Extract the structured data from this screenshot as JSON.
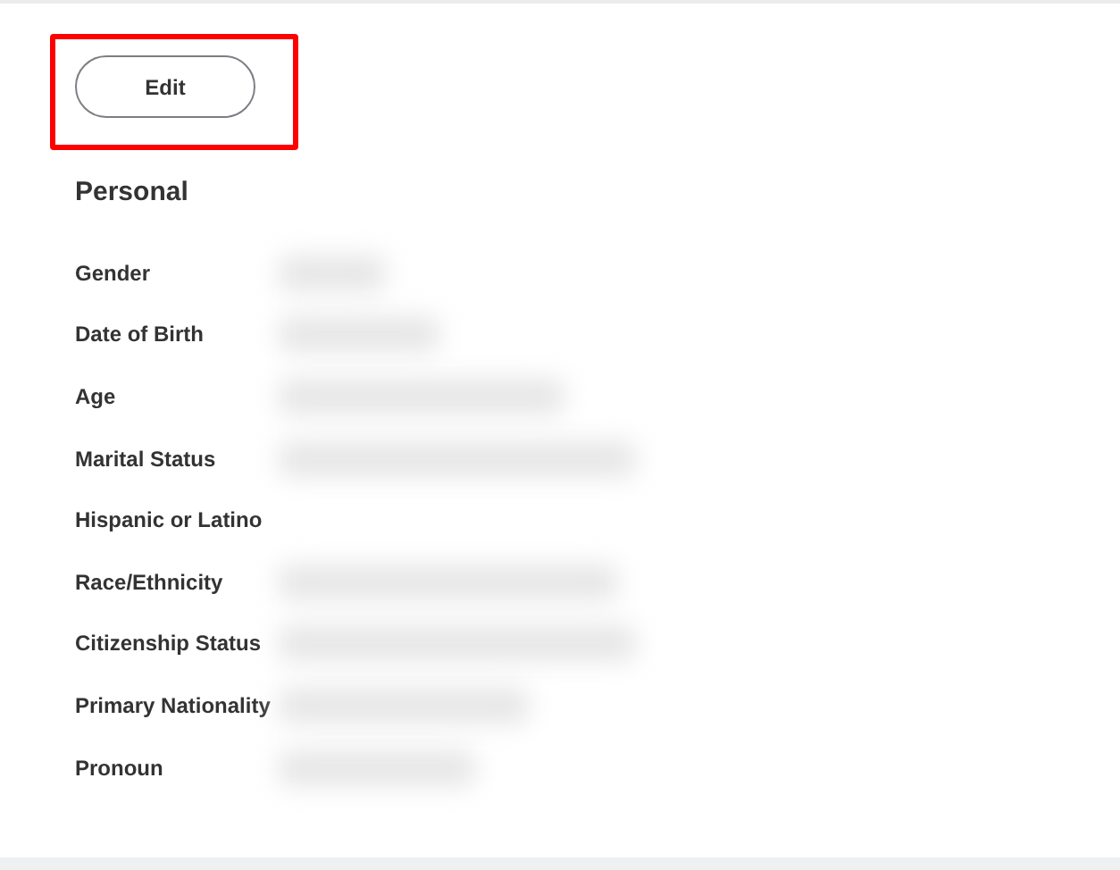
{
  "edit_button": {
    "label": "Edit",
    "highlighted": true
  },
  "section": {
    "title": "Personal",
    "fields": [
      {
        "label": "Gender",
        "redacted": true
      },
      {
        "label": "Date of Birth",
        "redacted": true
      },
      {
        "label": "Age",
        "redacted": true
      },
      {
        "label": "Marital Status",
        "redacted": true
      },
      {
        "label": "Hispanic or Latino",
        "redacted": false
      },
      {
        "label": "Race/Ethnicity",
        "redacted": true
      },
      {
        "label": "Citizenship Status",
        "redacted": true
      },
      {
        "label": "Primary Nationality",
        "redacted": true
      },
      {
        "label": "Pronoun",
        "redacted": true
      }
    ]
  }
}
